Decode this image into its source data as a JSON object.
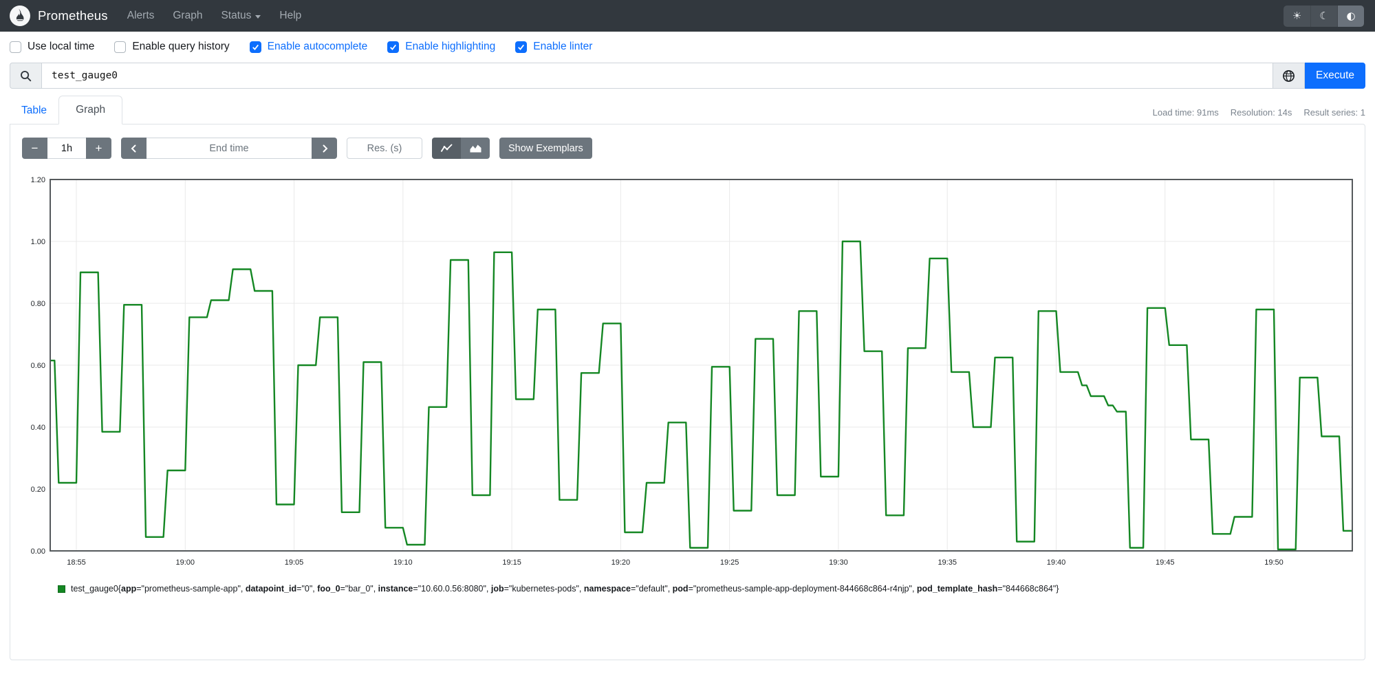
{
  "navbar": {
    "brand": "Prometheus",
    "items": [
      {
        "label": "Alerts",
        "dropdown": false
      },
      {
        "label": "Graph",
        "dropdown": false
      },
      {
        "label": "Status",
        "dropdown": true
      },
      {
        "label": "Help",
        "dropdown": false
      }
    ],
    "theme_toggle": {
      "options": [
        "light",
        "dark",
        "auto"
      ],
      "glyphs": [
        "☀",
        "☾",
        "◐"
      ],
      "active": "auto"
    }
  },
  "options": [
    {
      "label": "Use local time",
      "checked": false
    },
    {
      "label": "Enable query history",
      "checked": false
    },
    {
      "label": "Enable autocomplete",
      "checked": true
    },
    {
      "label": "Enable highlighting",
      "checked": true
    },
    {
      "label": "Enable linter",
      "checked": true
    }
  ],
  "query": {
    "value": "test_gauge0",
    "execute_label": "Execute"
  },
  "tabs": [
    {
      "label": "Table",
      "active": false
    },
    {
      "label": "Graph",
      "active": true
    }
  ],
  "stats": {
    "load_time": "Load time: 91ms",
    "resolution": "Resolution: 14s",
    "result_series": "Result series: 1"
  },
  "controls": {
    "decrease_range": "−",
    "range": "1h",
    "increase_range": "+",
    "end_time_placeholder": "End time",
    "resolution_placeholder": "Res. (s)",
    "show_exemplars": "Show Exemplars"
  },
  "chart_data": {
    "type": "line",
    "step": true,
    "title": "",
    "xlabel": "",
    "ylabel": "",
    "ylim": [
      0,
      1.2
    ],
    "grid": true,
    "legend_position": "bottom",
    "line_color": "#148723",
    "frame_color": "#55595c",
    "x_window": [
      "18:53.8",
      "19:53.6"
    ],
    "x_ticks": [
      "18:55",
      "19:00",
      "19:05",
      "19:10",
      "19:15",
      "19:20",
      "19:25",
      "19:30",
      "19:35",
      "19:40",
      "19:45",
      "19:50"
    ],
    "y_ticks": [
      0,
      0.2,
      0.4,
      0.6,
      0.8,
      1.0,
      1.2
    ],
    "series": [
      {
        "name": "test_gauge0",
        "color": "#148723",
        "points": [
          [
            "18:53.8",
            0.615
          ],
          [
            "18:54",
            0.22
          ],
          [
            "18:55",
            0.9
          ],
          [
            "18:56",
            0.385
          ],
          [
            "18:57",
            0.795
          ],
          [
            "18:58",
            0.045
          ],
          [
            "18:59",
            0.26
          ],
          [
            "19:00",
            0.755
          ],
          [
            "19:01",
            0.81
          ],
          [
            "19:02",
            0.91
          ],
          [
            "19:03",
            0.84
          ],
          [
            "19:04",
            0.15
          ],
          [
            "19:05",
            0.6
          ],
          [
            "19:06",
            0.755
          ],
          [
            "19:07",
            0.125
          ],
          [
            "19:08",
            0.61
          ],
          [
            "19:09",
            0.075
          ],
          [
            "19:10",
            0.02
          ],
          [
            "19:11",
            0.465
          ],
          [
            "19:12",
            0.94
          ],
          [
            "19:13",
            0.18
          ],
          [
            "19:14",
            0.965
          ],
          [
            "19:15",
            0.49
          ],
          [
            "19:16",
            0.78
          ],
          [
            "19:17",
            0.165
          ],
          [
            "19:18",
            0.575
          ],
          [
            "19:19",
            0.735
          ],
          [
            "19:20",
            0.06
          ],
          [
            "19:21",
            0.22
          ],
          [
            "19:22",
            0.415
          ],
          [
            "19:23",
            0.01
          ],
          [
            "19:24",
            0.595
          ],
          [
            "19:25",
            0.13
          ],
          [
            "19:26",
            0.685
          ],
          [
            "19:27",
            0.18
          ],
          [
            "19:28",
            0.775
          ],
          [
            "19:29",
            0.24
          ],
          [
            "19:30",
            1.0
          ],
          [
            "19:31",
            0.645
          ],
          [
            "19:32",
            0.115
          ],
          [
            "19:33",
            0.655
          ],
          [
            "19:34",
            0.945
          ],
          [
            "19:35",
            0.578
          ],
          [
            "19:36",
            0.4
          ],
          [
            "19:37",
            0.625
          ],
          [
            "19:38",
            0.03
          ],
          [
            "19:39",
            0.775
          ],
          [
            "19:40",
            0.578
          ],
          [
            "19:41",
            0.535
          ],
          [
            "19:41.4",
            0.5
          ],
          [
            "19:42.2",
            0.47
          ],
          [
            "19:42.6",
            0.45
          ],
          [
            "19:43.2",
            0.01
          ],
          [
            "19:44",
            0.785
          ],
          [
            "19:45",
            0.665
          ],
          [
            "19:46",
            0.36
          ],
          [
            "19:47",
            0.055
          ],
          [
            "19:48",
            0.11
          ],
          [
            "19:49",
            0.78
          ],
          [
            "19:50",
            0.005
          ],
          [
            "19:51",
            0.56
          ],
          [
            "19:52",
            0.37
          ],
          [
            "19:53",
            0.065
          ]
        ]
      }
    ]
  },
  "legend": {
    "metric": "test_gauge0",
    "swatch_color": "#148723",
    "labels": [
      [
        "app",
        "prometheus-sample-app"
      ],
      [
        "datapoint_id",
        "0"
      ],
      [
        "foo_0",
        "bar_0"
      ],
      [
        "instance",
        "10.60.0.56:8080"
      ],
      [
        "job",
        "kubernetes-pods"
      ],
      [
        "namespace",
        "default"
      ],
      [
        "pod",
        "prometheus-sample-app-deployment-844668c864-r4njp"
      ],
      [
        "pod_template_hash",
        "844668c864"
      ]
    ]
  }
}
